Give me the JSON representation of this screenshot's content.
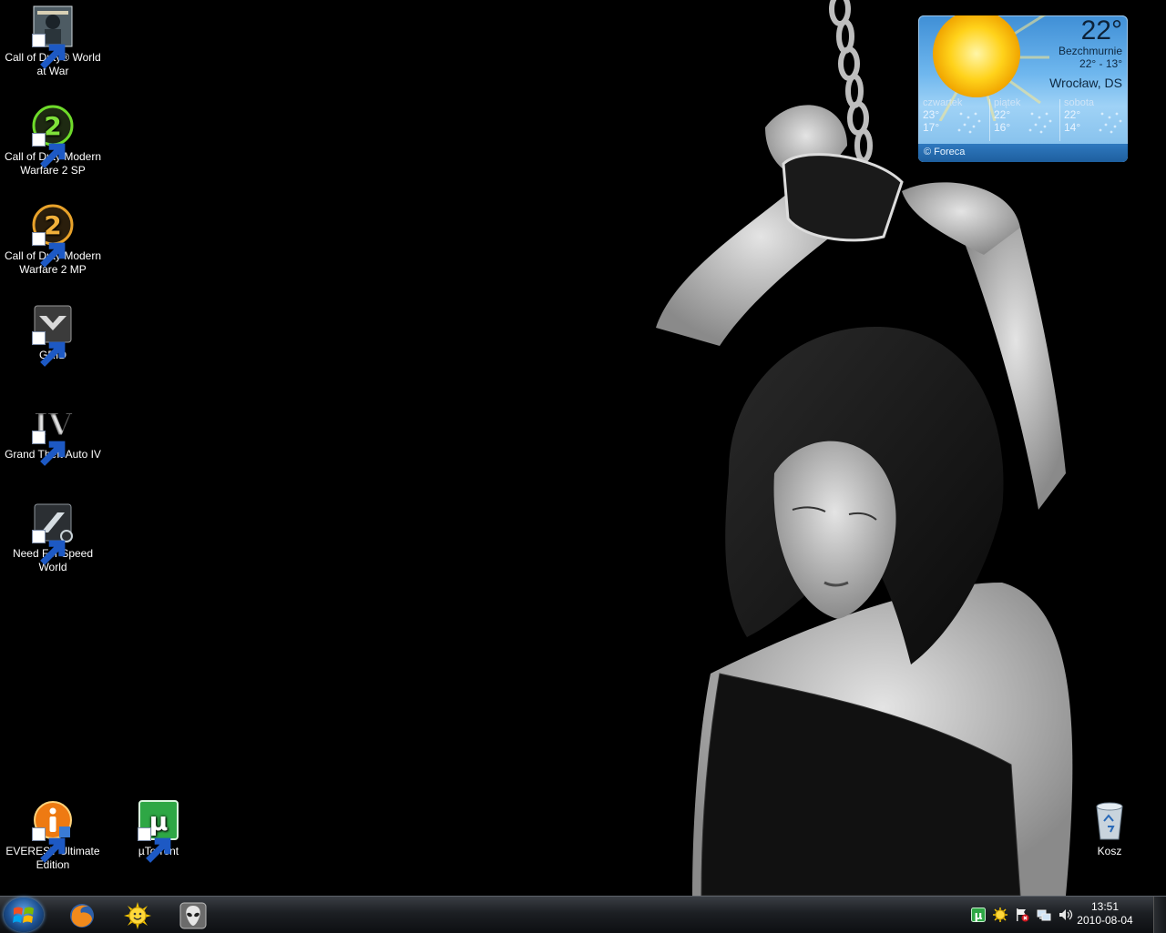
{
  "desktop": {
    "icons": [
      {
        "label": "Call of Duty® World at War",
        "icon": "cod-world-at-war-icon"
      },
      {
        "label": "Call of Duty Modern Warfare 2 SP",
        "icon": "cod-mw2-sp-icon"
      },
      {
        "label": "Call of Duty Modern Warfare 2 MP",
        "icon": "cod-mw2-mp-icon"
      },
      {
        "label": "GRID",
        "icon": "grid-icon"
      },
      {
        "label": "Grand Theft Auto IV",
        "icon": "gta-iv-icon"
      },
      {
        "label": "Need For Speed World",
        "icon": "nfs-world-icon"
      },
      {
        "label": "EVEREST Ultimate Edition",
        "icon": "everest-icon"
      },
      {
        "label": "µTorrent",
        "icon": "utorrent-icon"
      },
      {
        "label": "Kosz",
        "icon": "recycle-bin-icon"
      }
    ]
  },
  "weather": {
    "temp": "22°",
    "condition": "Bezchmurnie",
    "range": "22°  -  13°",
    "city": "Wrocław, DS",
    "forecast": [
      {
        "day": "czwartek",
        "high": "23°",
        "low": "17°"
      },
      {
        "day": "piątek",
        "high": "22°",
        "low": "16°"
      },
      {
        "day": "sobota",
        "high": "22°",
        "low": "14°"
      }
    ],
    "credit": "© Foreca"
  },
  "taskbar": {
    "pinned": [
      "start-orb-icon",
      "firefox-icon",
      "sun-smiley-icon",
      "alien-icon"
    ],
    "tray": [
      "utorrent-tray-icon",
      "sun-tray-icon",
      "action-center-flag-icon",
      "network-icon",
      "volume-icon"
    ],
    "clock": {
      "time": "13:51",
      "date": "2010-08-04"
    }
  }
}
